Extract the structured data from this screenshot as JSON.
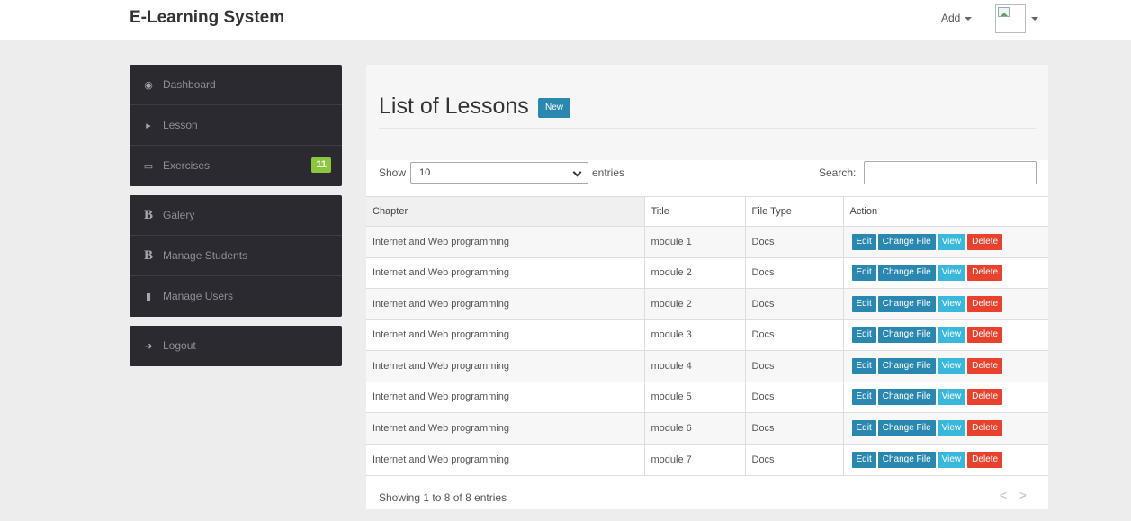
{
  "navbar": {
    "brand": "E-Learning System",
    "add_label": "Add"
  },
  "sidebar": {
    "group1": [
      {
        "icon": "dashboard-icon",
        "label": "Dashboard"
      },
      {
        "icon": "megaphone-icon",
        "label": "Lesson"
      },
      {
        "icon": "inbox-icon",
        "label": "Exercises",
        "badge": "11"
      }
    ],
    "group2": [
      {
        "icon": "b-icon",
        "label": "Galery"
      },
      {
        "icon": "b-icon",
        "label": "Manage Students"
      },
      {
        "icon": "book-icon",
        "label": "Manage Users"
      }
    ],
    "group3": [
      {
        "icon": "logout-icon",
        "label": "Logout"
      }
    ]
  },
  "main": {
    "title": "List of Lessons",
    "new_label": "New",
    "show_label": "Show",
    "page_length": "10",
    "entries_label": "entries",
    "search_label": "Search:",
    "columns": [
      "Chapter",
      "Title",
      "File Type",
      "Action"
    ],
    "rows": [
      {
        "chapter": "Internet and Web programming",
        "title": "module 1",
        "file_type": "Docs"
      },
      {
        "chapter": "Internet and Web programming",
        "title": "module 2",
        "file_type": "Docs"
      },
      {
        "chapter": "Internet and Web programming",
        "title": "module 2",
        "file_type": "Docs"
      },
      {
        "chapter": "Internet and Web programming",
        "title": "module 3",
        "file_type": "Docs"
      },
      {
        "chapter": "Internet and Web programming",
        "title": "module 4",
        "file_type": "Docs"
      },
      {
        "chapter": "Internet and Web programming",
        "title": "module 5",
        "file_type": "Docs"
      },
      {
        "chapter": "Internet and Web programming",
        "title": "module 6",
        "file_type": "Docs"
      },
      {
        "chapter": "Internet and Web programming",
        "title": "module 7",
        "file_type": "Docs"
      }
    ],
    "actions": {
      "edit": "Edit",
      "change_file": "Change File",
      "view": "View",
      "delete": "Delete"
    },
    "showing": "Showing 1 to 8 of 8 entries",
    "pager": {
      "prev": "<",
      "next": ">"
    }
  },
  "colors": {
    "sidebar_bg": "#2b2a30",
    "primary_button": "#2a87b0",
    "view_button": "#3ab8dc",
    "delete_button": "#e8422e",
    "badge": "#8cc63e"
  }
}
